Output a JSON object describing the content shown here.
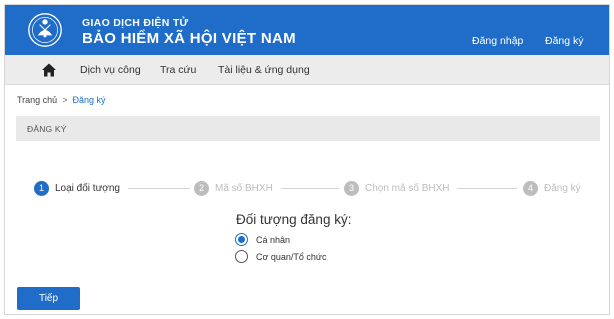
{
  "header": {
    "brand_top": "GIAO DỊCH ĐIỆN TỬ",
    "brand_main": "BẢO HIỂM XÃ HỘI VIỆT NAM",
    "login_label": "Đăng nhập",
    "register_label": "Đăng ký",
    "logo_icon": "vss-emblem-icon"
  },
  "nav": {
    "home_icon": "home-icon",
    "items": [
      {
        "label": "Dịch vụ công"
      },
      {
        "label": "Tra cứu"
      },
      {
        "label": "Tài liệu & ứng dụng"
      }
    ]
  },
  "breadcrumb": {
    "home": "Trang chủ",
    "separator": ">",
    "current": "Đăng ký"
  },
  "page": {
    "title": "ĐĂNG KÝ"
  },
  "steps": [
    {
      "number": "1",
      "label": "Loại đối tượng",
      "active": true
    },
    {
      "number": "2",
      "label": "Mã số BHXH",
      "active": false
    },
    {
      "number": "3",
      "label": "Chọn mã số BHXH",
      "active": false
    },
    {
      "number": "4",
      "label": "Đăng ký",
      "active": false
    }
  ],
  "form": {
    "heading": "Đối tượng đăng ký:",
    "options": [
      {
        "label": "Cá nhân",
        "selected": true
      },
      {
        "label": "Cơ quan/Tổ chức",
        "selected": false
      }
    ]
  },
  "actions": {
    "next_label": "Tiếp"
  },
  "colors": {
    "primary": "#1f6dc8",
    "inactive_step": "#bdbdbd",
    "nav_bg": "#ececec"
  }
}
